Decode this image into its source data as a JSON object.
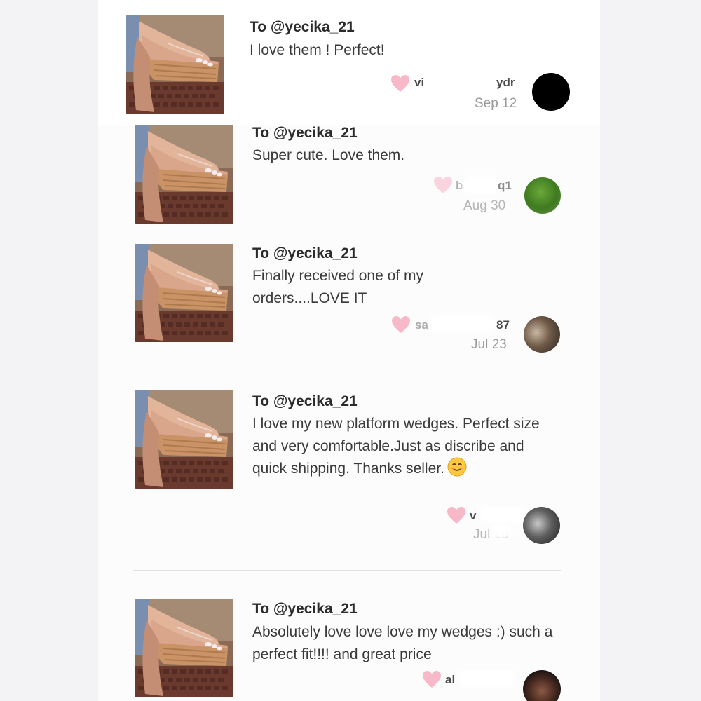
{
  "reviews": [
    {
      "to": "To @yecika_21",
      "text": "I love them ! Perfect!",
      "user_prefix": "vi",
      "user_suffix": "ydr",
      "date": "Sep 12",
      "colors": {
        "accent": "#f7b8c8"
      }
    },
    {
      "to": "To @yecika_21",
      "text": "Super cute. Love them.",
      "user_prefix": "b",
      "user_suffix": "q1",
      "date": "Aug 30"
    },
    {
      "to": "To @yecika_21",
      "text": "Finally received one of my orders....LOVE IT",
      "user_prefix": "sa",
      "user_suffix": "87",
      "date": "Jul 23"
    },
    {
      "to": "To @yecika_21",
      "text": "I love my new platform wedges. Perfect size and very comfortable.Just as discribe and quick shipping. Thanks seller.",
      "emoji": "smiling-face-emoji",
      "user_prefix": "v",
      "user_suffix": "",
      "date": "Jul 10"
    },
    {
      "to": "To @yecika_21",
      "text": "Absolutely love love love my wedges :) such a perfect fit!!!! and great price",
      "user_prefix": "al",
      "user_suffix": "",
      "date": ""
    }
  ],
  "icons": {
    "like": "heart-icon",
    "thumbnail": "product-thumbnail-wedge-sandal",
    "avatar": "user-avatar"
  },
  "colors": {
    "heart": "#f7b8c8",
    "text": "#3a3a3a",
    "date": "#9a9a9a",
    "divider": "#e3e1e4"
  }
}
